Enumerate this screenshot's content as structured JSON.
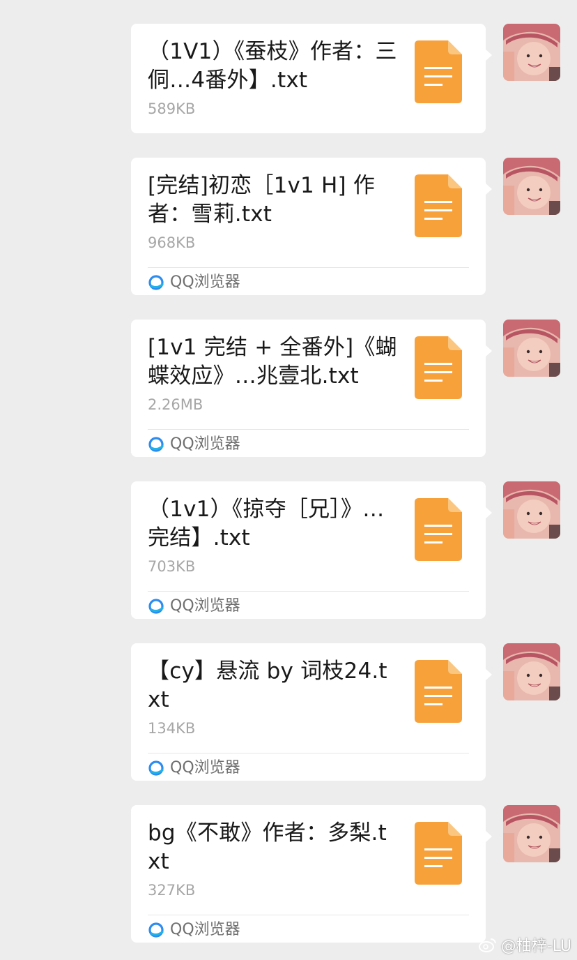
{
  "messages": [
    {
      "file_name": "（1V1）《蚕枝》作者：三侗…4番外】.txt",
      "size": "589KB",
      "source": null
    },
    {
      "file_name": "[完结]初恋［1v1 H] 作者：雪莉.txt",
      "size": "968KB",
      "source": "QQ浏览器"
    },
    {
      "file_name": "[1v1 完结 + 全番外]《蝴蝶效应》…兆壹北.txt",
      "size": "2.26MB",
      "source": "QQ浏览器"
    },
    {
      "file_name": "（1v1）《掠夺［兄］》…完结】.txt",
      "size": "703KB",
      "source": "QQ浏览器"
    },
    {
      "file_name": "【cy】悬流 by 词枝24.txt",
      "size": "134KB",
      "source": "QQ浏览器"
    },
    {
      "file_name": "bg《不敢》作者：多梨.txt",
      "size": "327KB",
      "source": "QQ浏览器"
    }
  ],
  "watermark": {
    "text": "@柚梓-LU"
  },
  "colors": {
    "background": "#ededed",
    "bubble": "#ffffff",
    "file_icon": "#f7a13b",
    "file_icon_fold": "#fbc67f",
    "qq_browser_icon": "#2d8cf0"
  }
}
